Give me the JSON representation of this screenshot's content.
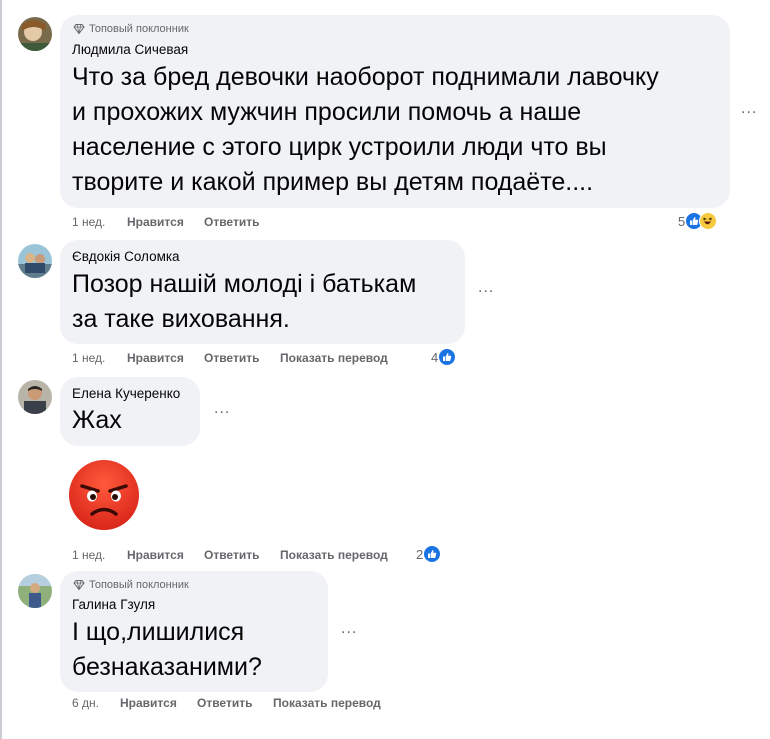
{
  "common": {
    "like_label": "Нравится",
    "reply_label": "Ответить",
    "translate_label": "Показать перевод",
    "top_fan_badge": "Топовый поклонник",
    "more_glyph": "...",
    "like_icon": "like-icon",
    "haha_icon": "haha-icon"
  },
  "comments": [
    {
      "author": "Людмила Сичевая",
      "top_fan": true,
      "lines": [
        "Что за бред девочки наоборот поднимали лавочку",
        "и прохожих мужчин просили помочь а наше",
        "население с этого цирк устроили люди что вы",
        "творите и какой пример вы детям подаёте...."
      ],
      "time": "1 нед.",
      "reactions": {
        "count": "5",
        "types": [
          "like",
          "haha"
        ]
      }
    },
    {
      "author": "Євдокія Соломка",
      "top_fan": false,
      "lines": [
        "Позор нашій молоді і батькам",
        "за таке виховання."
      ],
      "time": "1 нед.",
      "reactions": {
        "count": "4",
        "types": [
          "like"
        ]
      }
    },
    {
      "author": "Елена Кучеренко",
      "top_fan": false,
      "lines": [
        "Жах"
      ],
      "sticker": "angry-face-emoji",
      "time": "1 нед.",
      "reactions": {
        "count": "2",
        "types": [
          "like"
        ]
      }
    },
    {
      "author": "Галина Гзуля",
      "top_fan": true,
      "lines": [
        "І що,лишилися",
        "безнаказаними?"
      ],
      "time": "6 дн.",
      "reactions": null
    }
  ],
  "colors": {
    "bubble": "#f0f2f5",
    "like_blue": "#1b74e4",
    "meta_gray": "#65676b",
    "angry_red": "#e9331f"
  }
}
